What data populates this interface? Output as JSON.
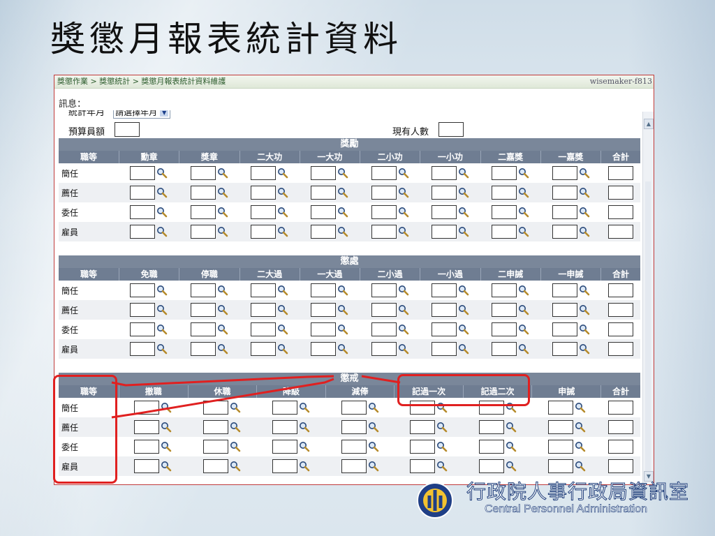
{
  "slide_title": "獎懲月報表統計資料",
  "app": {
    "breadcrumb": "獎懲作業 > 獎懲統計 > 獎懲月報表統計資料維護",
    "user_id": "wisemaker-f813",
    "message_label": "訊息：",
    "stat_month_label": "統計年月",
    "stat_month_select": "請選擇年月",
    "budget_label": "預算員額",
    "current_label": "現有人數"
  },
  "sections": {
    "rewards": {
      "title": "獎勵",
      "columns": [
        "職等",
        "勳章",
        "獎章",
        "二大功",
        "一大功",
        "二小功",
        "一小功",
        "二嘉獎",
        "一嘉獎",
        "合計"
      ],
      "grades": [
        "簡任",
        "薦任",
        "委任",
        "雇員"
      ]
    },
    "punishments": {
      "title": "懲處",
      "columns": [
        "職等",
        "免職",
        "停職",
        "二大過",
        "一大過",
        "二小過",
        "一小過",
        "二申誡",
        "一申誡",
        "合計"
      ],
      "grades": [
        "簡任",
        "薦任",
        "委任",
        "雇員"
      ]
    },
    "discipline": {
      "title": "懲戒",
      "columns": [
        "職等",
        "撤職",
        "休職",
        "降級",
        "減俸",
        "記過一次",
        "記過二次",
        "申誡",
        "合計"
      ],
      "grades": [
        "簡任",
        "薦任",
        "委任",
        "雇員"
      ]
    }
  },
  "footer": {
    "org_zh": "行政院人事行政局資訊室",
    "org_en": "Central Personnel Administration"
  },
  "colors": {
    "header_bg": "#6f7d92",
    "callout": "#e02020",
    "frame_border": "#c03a3a"
  },
  "icons": {
    "lookup": "magnifier-icon"
  }
}
